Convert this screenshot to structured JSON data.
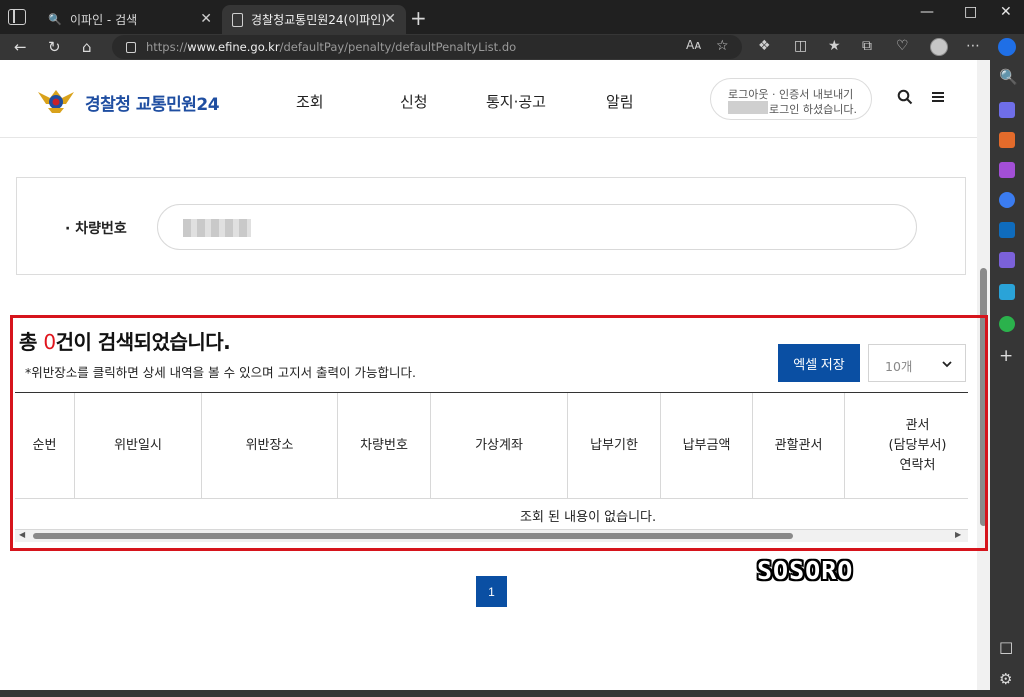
{
  "browser": {
    "tabs": [
      {
        "title": "이파인 - 검색",
        "favicon": "search-icon"
      },
      {
        "title": "경찰청교통민원24(이파인)",
        "favicon": "document-icon"
      }
    ],
    "url_scheme": "https://",
    "url_host": "www.efine.go.kr",
    "url_path": "/defaultPay/penalty/defaultPenaltyList.do",
    "accent": "#1f6fe6"
  },
  "site": {
    "brand_a": "경찰청",
    "brand_b": "교통민원24",
    "brand_color": "#1f4ea1",
    "menu": [
      "조회",
      "신청",
      "통지·공고",
      "알림"
    ],
    "login_line1": "로그아웃 · 인증서 내보내기",
    "login_line2": "로그인 하셨습니다."
  },
  "search": {
    "label": "차량번호",
    "placeholder": ""
  },
  "results": {
    "title_prefix": "총 ",
    "count": "0",
    "title_suffix": "건이 검색되었습니다.",
    "note": "*위반장소를 클릭하면 상세 내역을 볼 수 있으며 고지서 출력이 가능합니다.",
    "excel_button": "엑셀 저장",
    "page_size": "10개",
    "columns": [
      "순번",
      "위반일시",
      "위반장소",
      "차량번호",
      "가상계좌",
      "납부기한",
      "납부금액",
      "관할관서",
      "관서\n(담당부서)\n연락처"
    ],
    "empty_message": "조회 된 내용이 없습니다.",
    "highlight_color": "#d6141c",
    "button_color": "#0a4fa3"
  },
  "pagination": {
    "current": "1"
  },
  "watermark": "SOSORO"
}
